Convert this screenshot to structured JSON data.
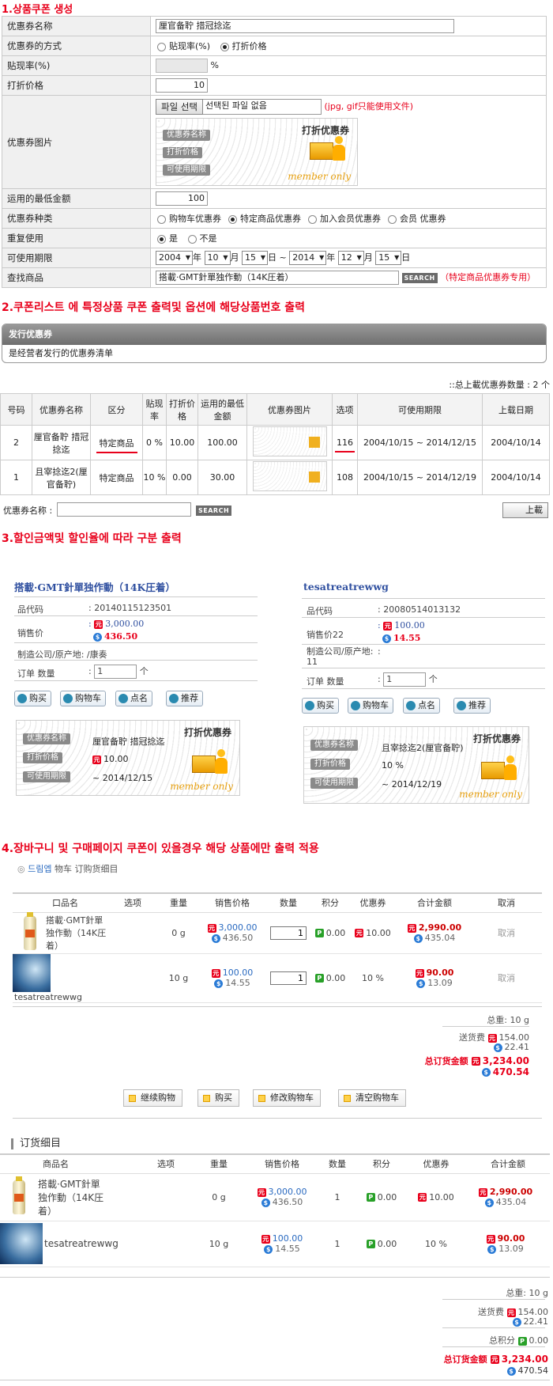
{
  "sections": {
    "s1": "1.상품쿠폰 생성",
    "s2": "2.쿠폰리스트 에 특정상품 쿠폰 출력및 옵션에 해당상품번호 출력",
    "s3": "3.할인금액및 할인율에 따라 구분 출력",
    "s4": "4.장바구니 및 구매페이지 쿠폰이 있을경우 해당 상품에만 출력 적용"
  },
  "form": {
    "labels": [
      "优惠券名称",
      "优惠券的方式",
      "贴现率(%)",
      "打折价格",
      "优惠券图片",
      "运用的最低金额",
      "优惠券种类",
      "重复使用",
      "可使用期限",
      "查找商品"
    ],
    "name_value": "厘官备聍 措冠捻迄",
    "method_options": [
      "贴现率(%)",
      "打折价格"
    ],
    "percent_unit": "%",
    "price_value": "10",
    "file_button": "파일 선택",
    "file_status": "선택된 파일 없음",
    "file_note": "(jpg, gif只能使用文件)",
    "min_amount": "100",
    "type_options": [
      "购物车优惠券",
      "特定商品优惠券",
      "加入会员优惠券",
      "会员 优惠券"
    ],
    "reuse_options": [
      "是",
      "不是"
    ],
    "date": {
      "y1": "2004",
      "m1": "10",
      "d1": "15",
      "y2": "2014",
      "m2": "12",
      "d2": "15",
      "year": "年",
      "month": "月",
      "day": "日",
      "sep": "~"
    },
    "search_value": "搭載·GMT針單独作動（14K圧着）",
    "search_button": "SEARCH",
    "search_note": "（特定商品优惠券专用）"
  },
  "coupon_img": {
    "title": "打折优惠券",
    "tags": [
      "优惠券名称",
      "打折价格",
      "可使用期限"
    ],
    "brand": "member only"
  },
  "bar": {
    "title": "发行优惠券",
    "subtitle": "是经营者发行的优惠券清单"
  },
  "list": {
    "total": "::总上載优惠券数量 : 2 个",
    "headers": [
      "号码",
      "优惠券名称",
      "区分",
      "贴现率",
      "打折价格",
      "运用的最低金额",
      "优惠券图片",
      "选项",
      "可使用期限",
      "上载日期"
    ],
    "rows": [
      {
        "no": "2",
        "name": "厘官备聍 措冠捻迄",
        "kind": "特定商品",
        "rate": "0 %",
        "price": "10.00",
        "min": "100.00",
        "opt": "116",
        "period": "2004/10/15 ~ 2014/12/15",
        "date": "2004/10/14"
      },
      {
        "no": "1",
        "name": "且宰捻迄2(厘官备聍)",
        "kind": "特定商品",
        "rate": "10 %",
        "price": "0.00",
        "min": "30.00",
        "opt": "108",
        "period": "2004/10/15 ~ 2014/12/19",
        "date": "2004/10/14"
      }
    ],
    "search_label": "优惠券名称 :",
    "search_button": "SEARCH",
    "upload_button": "上載"
  },
  "products": [
    {
      "name": "搭載·GMT針單独作動（14K圧着）",
      "code_label": "品代码",
      "code": "20140115123501",
      "price_label": "销售价",
      "price_yuan": "3,000.00",
      "price_usd": "436.50",
      "maker_label": "制造公司/原产地:",
      "maker": "/康奏",
      "qty_label": "订单 数量",
      "qty": "1",
      "qty_unit": "个",
      "buttons": [
        "购买",
        "购物车",
        "点名",
        "推荐"
      ],
      "coupon_name": "厘官备聍 措冠捻迄",
      "coupon_price": "10.00",
      "coupon_period": "~ 2014/12/15"
    },
    {
      "name": "tesatreatrewwg",
      "code_label": "品代码",
      "code": "20080514013132",
      "price_label": "销售价22",
      "price_yuan": "100.00",
      "price_usd": "14.55",
      "maker_label": "制造公司/原产地:",
      "maker": "11",
      "qty_label": "订单 数量",
      "qty": "1",
      "qty_unit": "个",
      "buttons": [
        "购买",
        "购物车",
        "点名",
        "推荐"
      ],
      "coupon_name": "且宰捻迄2(厘官备聍)",
      "coupon_price": "10 %",
      "coupon_period": "~ 2014/12/19"
    }
  ],
  "cart": {
    "breadcrumb_home": "드림엡",
    "breadcrumb": "物车 订购货细目",
    "headers": [
      "口品名",
      "选项",
      "重量",
      "销售价格",
      "数量",
      "积分",
      "优惠券",
      "合计金额",
      "取消"
    ],
    "rows": [
      {
        "name": "搭載·GMT針單独作動（14K圧着）",
        "weight": "0 g",
        "yuan": "3,000.00",
        "usd": "436.50",
        "qty": "1",
        "point": "0.00",
        "coupon": "10.00",
        "total_yuan": "2,990.00",
        "total_usd": "435.04",
        "cancel": "取消"
      },
      {
        "name": "tesatreatrewwg",
        "weight": "10 g",
        "yuan": "100.00",
        "usd": "14.55",
        "qty": "1",
        "point": "0.00",
        "coupon": "10 %",
        "total_yuan": "90.00",
        "total_usd": "13.09",
        "cancel": "取消"
      }
    ],
    "weight_total": "总重: 10 g",
    "ship_label": "送货费",
    "ship_yuan": "154.00",
    "ship_usd": "22.41",
    "grand_label": "总订货金额",
    "grand_yuan": "3,234.00",
    "grand_usd": "470.54",
    "actions": [
      "继续购物",
      "购买",
      "修改购物车",
      "清空购物车"
    ]
  },
  "order": {
    "title": "订货细目",
    "headers": [
      "商品名",
      "选项",
      "重量",
      "销售价格",
      "数量",
      "积分",
      "优惠券",
      "合计金额"
    ],
    "rows": [
      {
        "name": "搭載·GMT針單独作動（14K圧着）",
        "weight": "0 g",
        "yuan": "3,000.00",
        "usd": "436.50",
        "qty": "1",
        "point": "0.00",
        "coupon": "10.00",
        "total_yuan": "2,990.00",
        "total_usd": "435.04"
      },
      {
        "name": "tesatreatrewwg",
        "weight": "10 g",
        "yuan": "100.00",
        "usd": "14.55",
        "qty": "1",
        "point": "0.00",
        "coupon": "10 %",
        "total_yuan": "90.00",
        "total_usd": "13.09"
      }
    ],
    "weight_total": "总重: 10 g",
    "ship_label": "送货费",
    "ship_yuan": "154.00",
    "ship_usd": "22.41",
    "points_label": "总积分",
    "points": "0.00",
    "grand_label": "总订货金额",
    "grand_yuan": "3,234.00",
    "grand_usd": "470.54"
  }
}
